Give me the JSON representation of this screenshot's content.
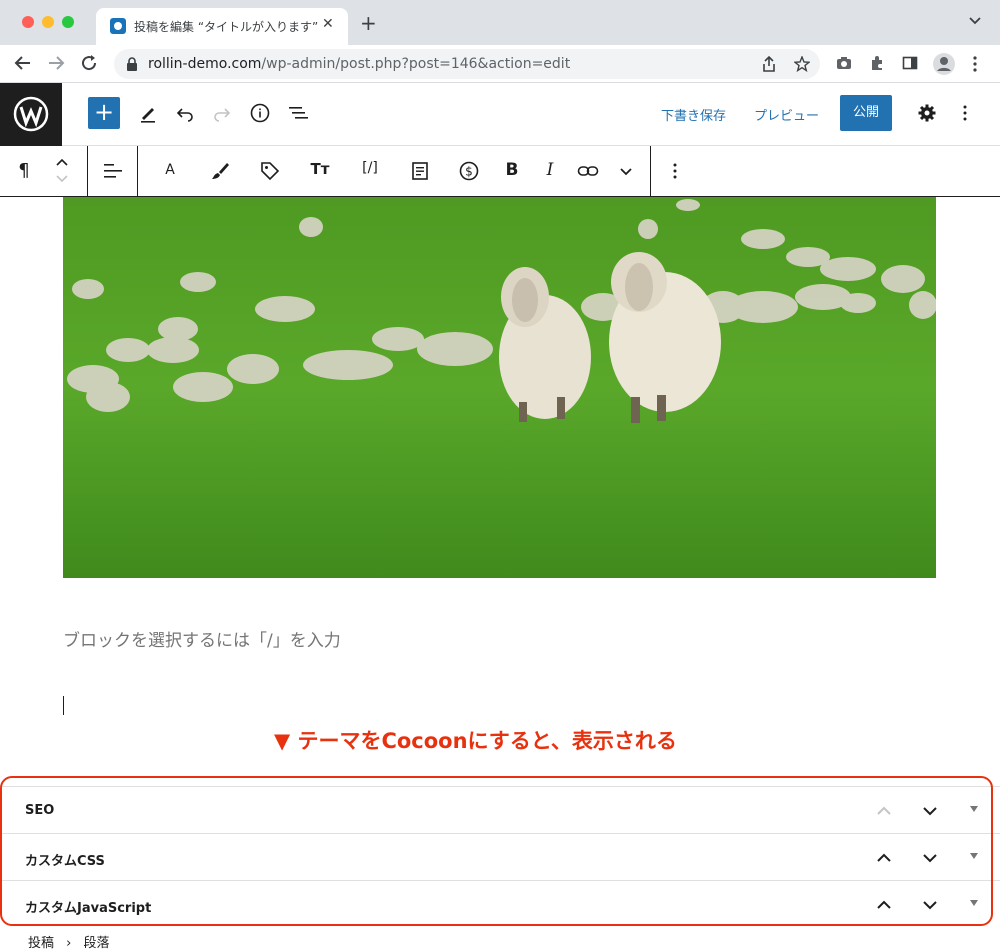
{
  "browser": {
    "tab_title": "投稿を編集 “タイトルが入ります”",
    "url_host": "rollin-demo.com",
    "url_path": "/wp-admin/post.php?post=146&action=edit"
  },
  "wp_toolbar": {
    "add_block_label": "+",
    "save_draft_label": "下書き保存",
    "preview_label": "プレビュー",
    "publish_label": "公開"
  },
  "block_toolbar": {
    "paragraph_label": "¶",
    "font_label": "A",
    "font_size_label": "Tт",
    "shortcode_label": "[/]",
    "bold_label": "B",
    "italic_label": "I"
  },
  "editor": {
    "placeholder": "ブロックを選択するには「/」を入力",
    "annotation": "▼ テーマをCocoonにすると、表示される",
    "image_alt": "sheep on grass"
  },
  "panels": [
    {
      "title": "SEO"
    },
    {
      "title": "カスタムCSS"
    },
    {
      "title": "カスタムJavaScript"
    }
  ],
  "breadcrumb": {
    "item1": "投稿",
    "separator": "›",
    "item2": "段落"
  },
  "colors": {
    "wp_blue": "#2271b1",
    "annotation_red": "#e8320f",
    "grass": "#5aa82a"
  }
}
